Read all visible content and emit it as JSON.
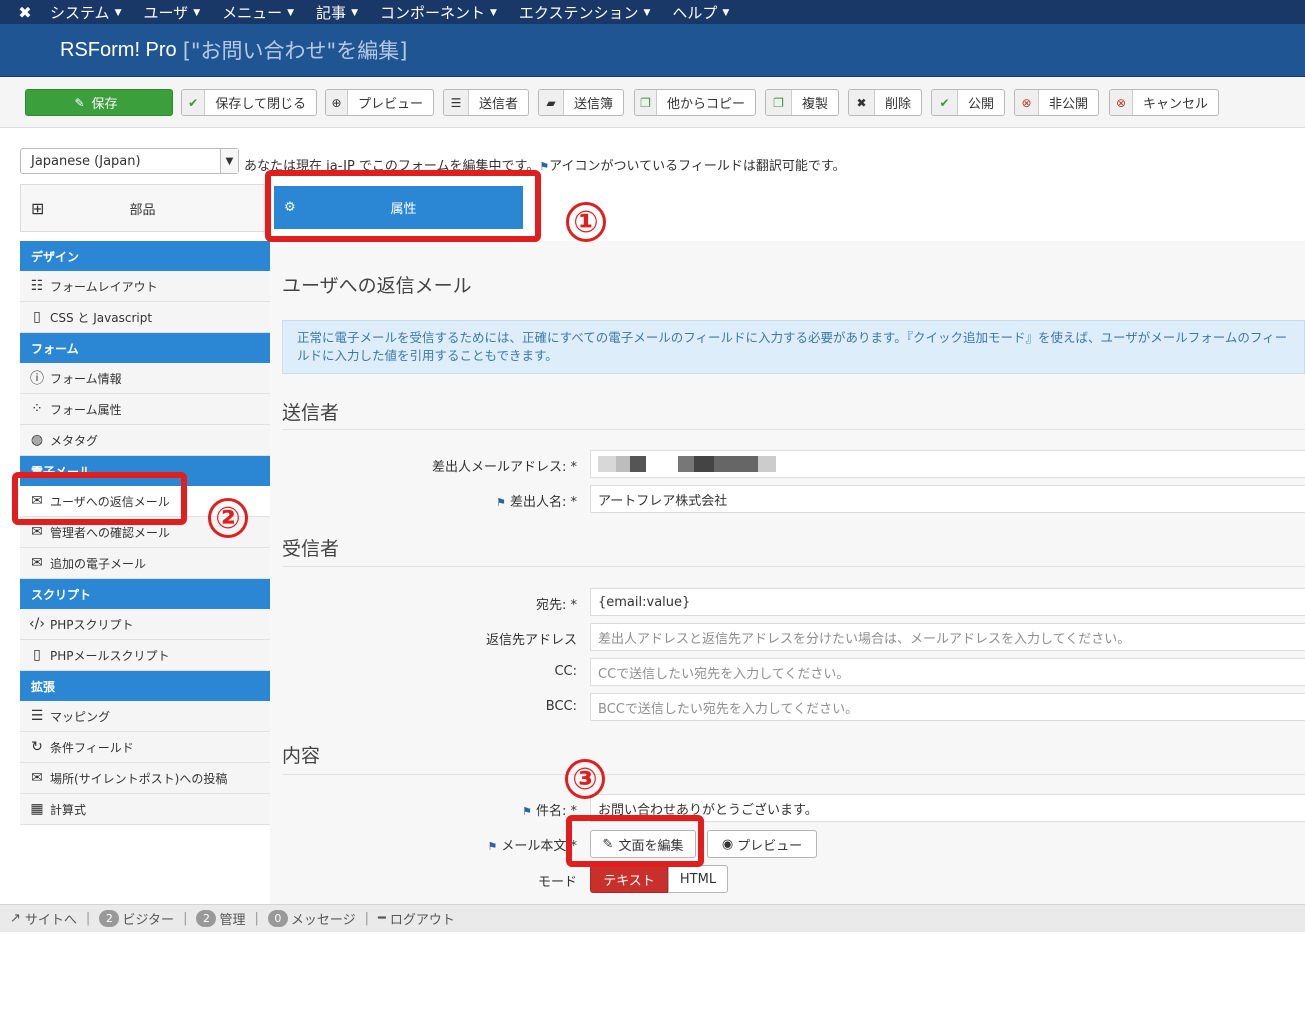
{
  "topmenu": {
    "logo_icon": "joomla-icon",
    "items": [
      "システム",
      "ユーザ",
      "メニュー",
      "記事",
      "コンポーネント",
      "エクステンション",
      "ヘルプ"
    ]
  },
  "title": {
    "app": "RSForm! Pro",
    "document": "[\"お問い合わせ\"を編集]"
  },
  "toolbar": {
    "save": "保存",
    "save_close": "保存して閉じる",
    "preview": "プレビュー",
    "submitters": "送信者",
    "submission_dir": "送信簿",
    "copy_from": "他からコピー",
    "duplicate": "複製",
    "delete": "削除",
    "publish": "公開",
    "unpublish": "非公開",
    "cancel": "キャンセル"
  },
  "language": {
    "selected": "Japanese (Japan)",
    "note": "あなたは現在 ja-JP でこのフォームを編集中です。",
    "note2": "アイコンがついているフィールドは翻訳可能です。"
  },
  "tabs": {
    "components": "部品",
    "properties": "属性"
  },
  "sidebar": {
    "design_head": "デザイン",
    "form_layout": "フォームレイアウト",
    "css_js": "CSS と Javascript",
    "form_head": "フォーム",
    "form_info": "フォーム情報",
    "form_attributes": "フォーム属性",
    "meta_tags": "メタタグ",
    "email_head": "電子メール",
    "user_reply": "ユーザへの返信メール",
    "admin_confirm": "管理者への確認メール",
    "additional_emails": "追加の電子メール",
    "script_head": "スクリプト",
    "php_scripts": "PHPスクリプト",
    "php_email_scripts": "PHPメールスクリプト",
    "ext_head": "拡張",
    "mappings": "マッピング",
    "conditional_fields": "条件フィールド",
    "silent_post": "場所(サイレントポスト)への投稿",
    "calculations": "計算式"
  },
  "main": {
    "heading": "ユーザへの返信メール",
    "alert": "正常に電子メールを受信するためには、正確にすべての電子メールのフィールドに入力する必要があります。『クイック追加モード』を使えば、ユーザがメールフォームのフィールドに入力した値を引用することもできます。",
    "sender_title": "送信者",
    "from_label": "差出人メールアドレス: *",
    "from_name_label": "差出人名: *",
    "from_name_value": "アートフレア株式会社",
    "recipient_title": "受信者",
    "to_label": "宛先: *",
    "to_value": "{email:value}",
    "reply_to_label": "返信先アドレス",
    "reply_to_placeholder": "差出人アドレスと返信先アドレスを分けたい場合は、メールアドレスを入力してください。",
    "cc_label": "CC:",
    "cc_placeholder": "CCで送信したい宛先を入力してください。",
    "bcc_label": "BCC:",
    "bcc_placeholder": "BCCで送信したい宛先を入力してください。",
    "content_title": "内容",
    "subject_label": "件名: *",
    "subject_value": "お問い合わせありがとうございます。",
    "body_label": "メール本文 *",
    "edit_text_button": "文面を編集",
    "preview_button": "プレビュー",
    "mode_label": "モード",
    "mode_text": "テキスト",
    "mode_html": "HTML"
  },
  "annotations": [
    "①",
    "②",
    "③"
  ],
  "statusbar": {
    "site": "サイトへ",
    "visitors_count": "2",
    "visitors": "ビジター",
    "admins_count": "2",
    "admins": "管理",
    "messages_count": "0",
    "messages": "メッセージ",
    "logout": "ログアウト"
  },
  "colors": {
    "topbar": "#1a3867",
    "titlebar": "#1f5592",
    "accent": "#2b87d4",
    "save_green": "#3b9f3b",
    "annotation_red": "#e01e1e"
  }
}
